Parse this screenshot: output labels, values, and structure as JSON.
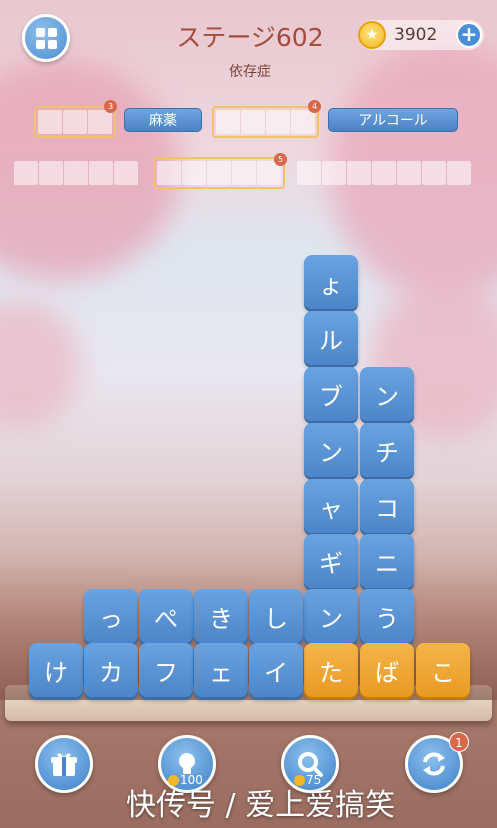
{
  "header": {
    "title": "ステージ602",
    "subtitle": "依存症",
    "coins": "3902"
  },
  "words": [
    {
      "slots": 3,
      "badge": "3"
    },
    {
      "label": "麻薬"
    },
    {
      "slots": 4,
      "badge": "4"
    },
    {
      "label": "アルコール"
    },
    {
      "slots": 5
    },
    {
      "slots": 5,
      "badge": "5"
    },
    {
      "slots": 7
    }
  ],
  "tiles": {
    "col6": [
      "ょ",
      "ル",
      "ブ",
      "ン",
      "ャ",
      "ギ",
      "ン",
      "た"
    ],
    "col7": [
      "ン",
      "チ",
      "コ",
      "ニ",
      "う",
      "ば"
    ],
    "row_mid": [
      "っ",
      "ぺ",
      "き",
      "し"
    ],
    "row_bottom": [
      "け",
      "カ",
      "フ",
      "ェ",
      "イ"
    ],
    "gold_last": "こ"
  },
  "actions": {
    "hint_cost": "100",
    "search_cost": "75",
    "refresh_badge": "1"
  },
  "watermark": "快传号 / 爱上爱搞笑",
  "colors": {
    "tile_blue": "#5a93d4",
    "tile_gold": "#ee a52e",
    "title": "#a34c3c"
  }
}
